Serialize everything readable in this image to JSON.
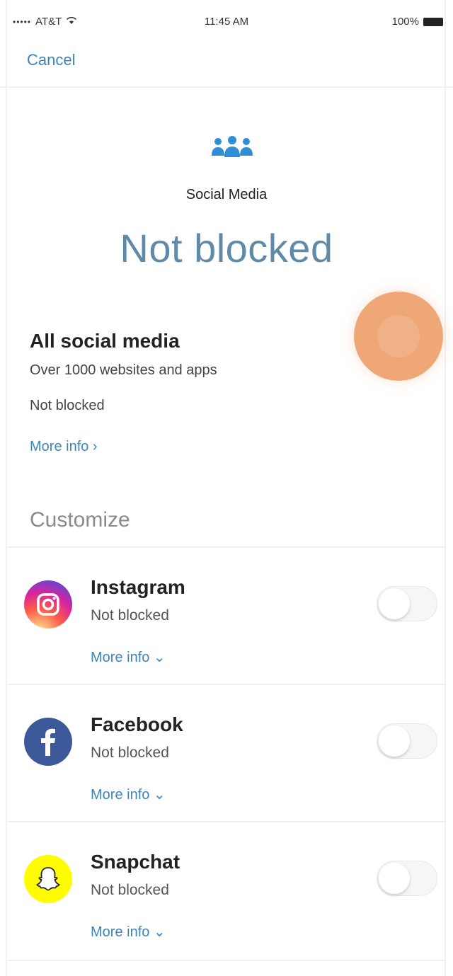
{
  "status_bar": {
    "carrier": "AT&T",
    "signal": "•••••",
    "time": "11:45 AM",
    "battery": "100%"
  },
  "nav": {
    "cancel_label": "Cancel"
  },
  "header": {
    "category": "Social Media",
    "status": "Not blocked",
    "icon": "people-group-icon",
    "icon_color": "#2f8fd4"
  },
  "all_social": {
    "title": "All social media",
    "subtitle": "Over 1000 websites and apps",
    "status": "Not blocked",
    "more_info": "More info ›"
  },
  "customize_label": "Customize",
  "apps": [
    {
      "name": "Instagram",
      "status": "Not blocked",
      "more_info": "More info ⌄",
      "icon": "instagram-icon",
      "enabled": false
    },
    {
      "name": "Facebook",
      "status": "Not blocked",
      "more_info": "More info ⌄",
      "icon": "facebook-icon",
      "enabled": false
    },
    {
      "name": "Snapchat",
      "status": "Not blocked",
      "more_info": "More info ⌄",
      "icon": "snapchat-icon",
      "enabled": false
    }
  ],
  "colors": {
    "link": "#3d86b8",
    "status_large": "#5f8aa8",
    "touch_indicator": "#f0a777",
    "facebook": "#3b5998",
    "snapchat": "#fffc00"
  }
}
